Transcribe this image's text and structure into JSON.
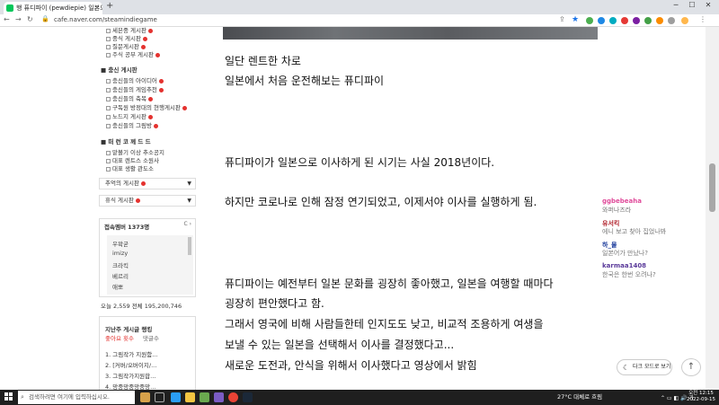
{
  "browser": {
    "tab_title": "행 퓨디파이 (pewdiepie) 일본으...",
    "url": "cafe.naver.com/steamindiegame",
    "new_tab_symbol": "+"
  },
  "sidebar": {
    "top_items": [
      "세븐중 게시판",
      "중식 게시판",
      "질문게시판",
      "주식 공부 게시판"
    ],
    "section1_title": "■ 충신 게시판",
    "section1_items": [
      "충신들의 아이디어",
      "충신들의 게임추천",
      "충신들의 축복",
      "구독원 방정대의 현행게시판",
      "노드지 게시판",
      "충신들의 그림방"
    ],
    "section2_title": "■ 떠 런 코 께 드 드",
    "section2_items": [
      "맡볼기 이상 추소공지",
      "대표 렌트스 소원사",
      "대표 생활 관도소"
    ],
    "box1": "추억의 게시판",
    "box2": "휴식 게시판",
    "members_title": "접속멤버 1373명",
    "members_ctl": "C ›",
    "members": [
      "우왁굳",
      "imizy",
      "크라킥",
      "베르리",
      "애뽀"
    ],
    "stats": "오늘 2,559   전체 195,200,746",
    "ranking_title": "지난주 게시글 랭킹",
    "ranking_tab1": "좋아요 횟수",
    "ranking_tab2": "댓글수",
    "ranking_items": [
      "1. 그림작가 지원함...",
      "2. [커버/오버이지/...",
      "3. 그림작가지원합...",
      "4. 망중망중망중망..."
    ]
  },
  "main": {
    "lines": [
      "일단 렌트한 차로",
      "일본에서 처음 운전해보는 퓨디파이",
      "퓨디파이가 일본으로 이사하게 된 시기는 사실 2018년이다.",
      "하지만 코로나로 인해 잠정 연기되었고, 이제서야 이사를 실행하게 됨.",
      "퓨디파이는 예전부터 일본 문화를 굉장히 좋아했고, 일본을 여행할 때마다",
      "굉장히 편안했다고 함.",
      "그래서 영국에 비해 사람들한테 인지도도 낮고, 비교적 조용하게 여생을",
      "보낼 수 있는 일본을 선택해서 이사를 결정했다고...",
      "새로운 도전과, 안식을 위해서 이사했다고 영상에서 밝힘"
    ]
  },
  "chat": [
    {
      "user": "ggbebeaha",
      "msg": "와퍼나즈라",
      "color": "#e04a9a"
    },
    {
      "user": "유서킥",
      "msg": "에니 보고 찾아 집었나봐",
      "color": "#b0202a"
    },
    {
      "user": "하_물",
      "msg": "일본어가 만났나?",
      "color": "#1a3a9a"
    },
    {
      "user": "karmaa1408",
      "msg": "한국은 한번 오려나?",
      "color": "#5a3a9a"
    }
  ],
  "dark_mode_label": "다크 모드로 보기",
  "top_button": "↑",
  "taskbar": {
    "search_placeholder": "검색하려면 여기에 입력하십시오.",
    "weather": "27°C 대체로 흐림",
    "clock_time": "오전 12:15",
    "clock_date": "2022-09-15"
  }
}
